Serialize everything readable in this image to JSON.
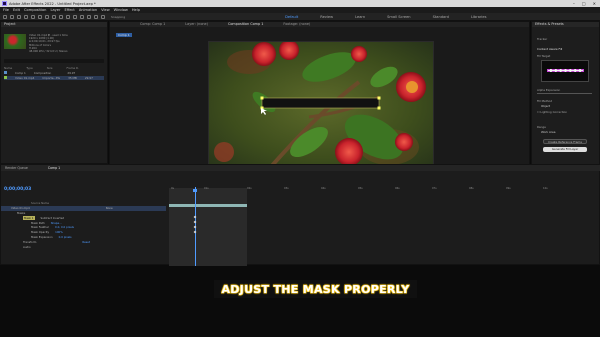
{
  "window": {
    "title": "Adobe After Effects 2022 - Untitled Project.aep *"
  },
  "menu": [
    "File",
    "Edit",
    "Composition",
    "Layer",
    "Effect",
    "Animation",
    "View",
    "Window",
    "Help"
  ],
  "toolbar": {
    "snapping": "Snapping",
    "workspaces": [
      "Default",
      "Review",
      "Learn",
      "Small Screen",
      "Standard",
      "Libraries"
    ]
  },
  "project": {
    "tab": "Project",
    "info": [
      "Video 01.mp4 ▼ , used 1 time",
      "1920 x 1080 (1.00)",
      "Δ 0;00;10;01, 29.97 fps",
      "Millions of Colors",
      "H.264",
      "48.000 kHz / 32 bit U / Stereo"
    ],
    "columns": [
      "Name",
      "Type",
      "Size",
      "Frame R."
    ],
    "items": [
      {
        "name": "Comp 1",
        "type": "Composition",
        "size": "",
        "fps": "29.97"
      },
      {
        "name": "Video 01.mp4",
        "type": "Importe...EG",
        "size": "35 MB",
        "fps": "29.97"
      }
    ]
  },
  "viewer": {
    "tabs": [
      "Comp: Comp 1",
      "Layer: (none)",
      "Composition Comp 1",
      "Footage: (none)"
    ],
    "active_tab": "Composition Comp 1",
    "chip": "Comp 1",
    "zoom": "100%",
    "quality": "(Half)",
    "timecode": "0;00;00;03"
  },
  "effects": {
    "tab": "Effects & Presets",
    "sub": "Tracker",
    "title": "Content Aware Fill",
    "fill_target": "Fill Target",
    "alpha_expansion": "Alpha Expansion",
    "fill_method": "Fill Method",
    "fill_method_value": "Object",
    "lighting_correction": "Lighting Correction",
    "range": "Range",
    "range_value": "Work Area",
    "create_ref": "Create Reference Frame",
    "generate": "Generate Fill Layer"
  },
  "timeline": {
    "tabs": [
      "Render Queue",
      "Comp 1"
    ],
    "timecode": "0;00;00;03",
    "rows": [
      {
        "label": "Source Name",
        "value": ""
      },
      {
        "label": "Video 01.mp4",
        "value": "None"
      },
      {
        "label": "Masks",
        "value": ""
      },
      {
        "label": "Mask 1",
        "value": "Subtract   Inverted"
      },
      {
        "label": "Mask Path",
        "value": "Shape..."
      },
      {
        "label": "Mask Feather",
        "value": "0.0, 0.0 pixels"
      },
      {
        "label": "Mask Opacity",
        "value": "100%"
      },
      {
        "label": "Mask Expansion",
        "value": "0.0 pixels"
      },
      {
        "label": "Transform",
        "value": "Reset"
      },
      {
        "label": "Audio",
        "value": ""
      }
    ],
    "ruler": [
      "0s",
      "01s",
      "02s",
      "03s",
      "04s",
      "05s",
      "06s",
      "07s",
      "08s",
      "09s",
      "10s"
    ]
  },
  "caption": "ADJUST THE MASK PROPERLY"
}
